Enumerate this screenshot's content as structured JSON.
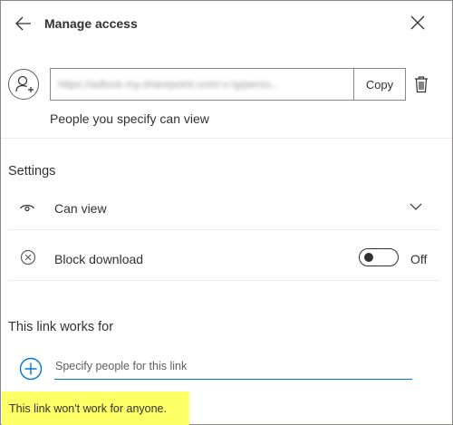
{
  "header": {
    "title": "Manage access",
    "back_icon": "arrow-left-icon",
    "close_icon": "close-icon"
  },
  "link": {
    "url": "https://adlock-my.sharepoint.com/:v:/g/perso...",
    "copy_label": "Copy",
    "description": "People you specify can view",
    "avatar_icon": "person-add-icon",
    "delete_icon": "trash-icon"
  },
  "settings": {
    "heading": "Settings",
    "permission": {
      "label": "Can view",
      "icon": "eye-icon"
    },
    "block_download": {
      "label": "Block download",
      "icon": "block-icon",
      "state_label": "Off",
      "enabled": false
    }
  },
  "works_for": {
    "heading": "This link works for",
    "input_placeholder": "Specify people for this link",
    "input_value": "",
    "add_icon": "plus-circle-icon"
  },
  "warning": {
    "text": "This link won't work for anyone.",
    "highlight_color": "#ffff66"
  },
  "colors": {
    "accent": "#0078d4",
    "text": "#323130",
    "border": "#8a8886"
  }
}
